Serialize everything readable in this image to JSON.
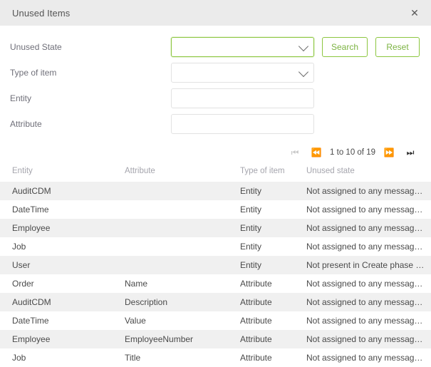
{
  "dialog": {
    "title": "Unused Items",
    "close_icon": "close-icon",
    "close_label": "✕"
  },
  "form": {
    "fields": [
      {
        "label": "Unused State",
        "type": "select",
        "value": "",
        "focused": true
      },
      {
        "label": "Type of item",
        "type": "select",
        "value": "",
        "focused": false
      },
      {
        "label": "Entity",
        "type": "text",
        "value": "",
        "placeholder": ""
      },
      {
        "label": "Attribute",
        "type": "text",
        "value": "",
        "placeholder": ""
      }
    ],
    "buttons": {
      "search_label": "Search",
      "reset_label": "Reset"
    }
  },
  "pagination": {
    "first_icon": "⏮",
    "prev_icon": "⏪",
    "next_icon": "⏩",
    "last_icon": "⏭",
    "range_text": "1 to 10 of 19",
    "first_enabled": false,
    "prev_enabled": false,
    "next_enabled": true,
    "last_enabled": true
  },
  "table": {
    "columns": [
      "Entity",
      "Attribute",
      "Type of item",
      "Unused state"
    ],
    "rows": [
      {
        "entity": "AuditCDM",
        "attribute": "",
        "type": "Entity",
        "state": "Not assigned to any message ty..."
      },
      {
        "entity": "DateTime",
        "attribute": "",
        "type": "Entity",
        "state": "Not assigned to any message ty..."
      },
      {
        "entity": "Employee",
        "attribute": "",
        "type": "Entity",
        "state": "Not assigned to any message ty..."
      },
      {
        "entity": "Job",
        "attribute": "",
        "type": "Entity",
        "state": "Not assigned to any message ty..."
      },
      {
        "entity": "User",
        "attribute": "",
        "type": "Entity",
        "state": "Not present in Create phase int..."
      },
      {
        "entity": "Order",
        "attribute": "Name",
        "type": "Attribute",
        "state": "Not assigned to any message ty..."
      },
      {
        "entity": "AuditCDM",
        "attribute": "Description",
        "type": "Attribute",
        "state": "Not assigned to any message ty..."
      },
      {
        "entity": "DateTime",
        "attribute": "Value",
        "type": "Attribute",
        "state": "Not assigned to any message ty..."
      },
      {
        "entity": "Employee",
        "attribute": "EmployeeNumber",
        "type": "Attribute",
        "state": "Not assigned to any message ty..."
      },
      {
        "entity": "Job",
        "attribute": "Title",
        "type": "Attribute",
        "state": "Not assigned to any message ty..."
      }
    ]
  },
  "colors": {
    "accent_green": "#8cc63f",
    "accent_green_text": "#7cb342",
    "titlebar_bg": "#ebebeb",
    "row_stripe": "#f0f0f0"
  }
}
